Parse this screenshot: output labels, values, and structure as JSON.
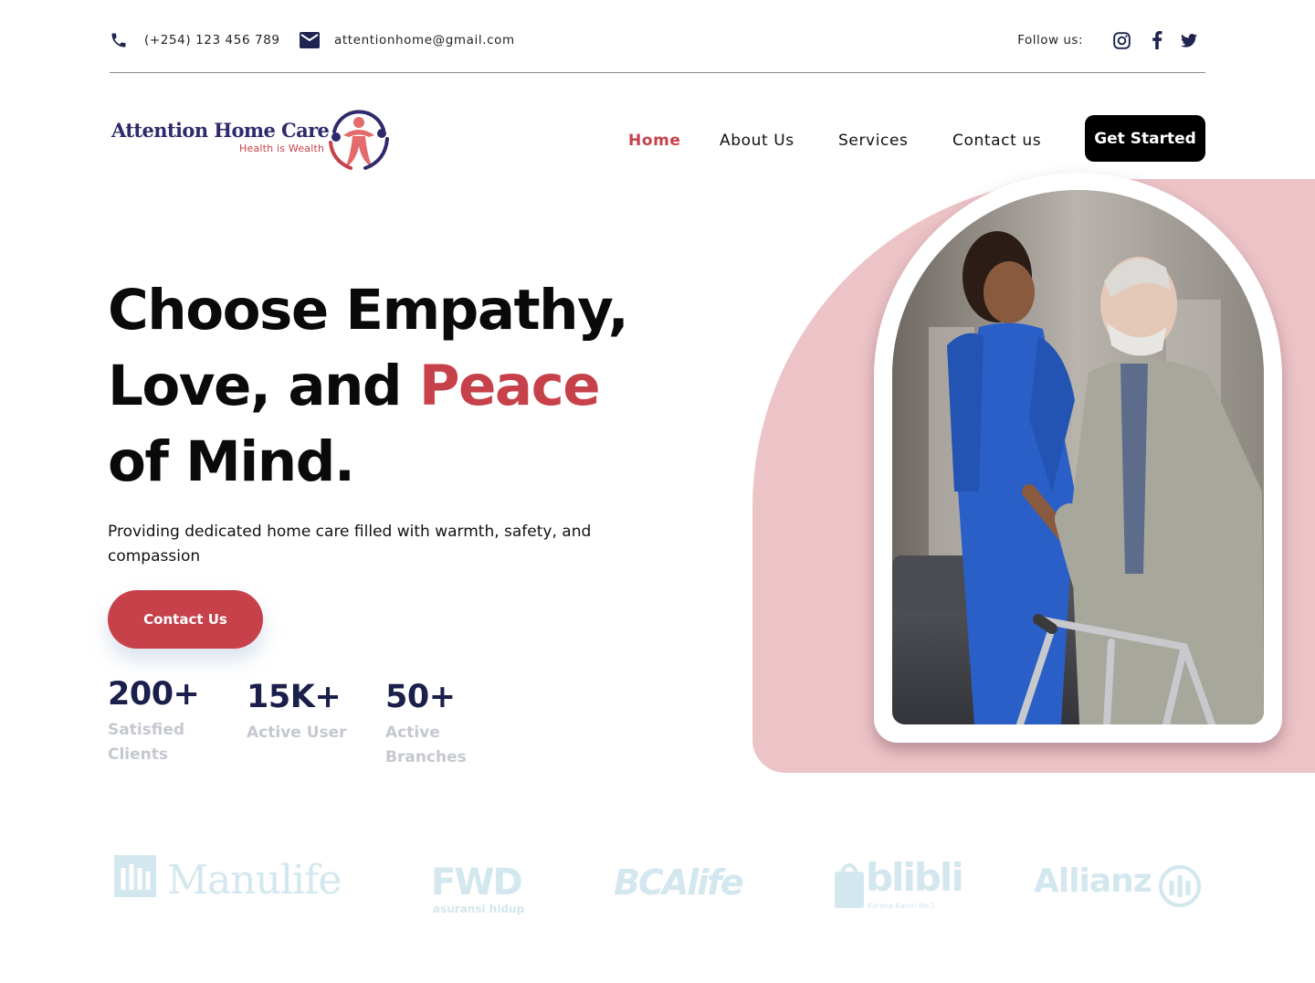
{
  "topbar": {
    "phone": "(+254) 123 456 789",
    "email": "attentionhome@gmail.com",
    "follow_label": "Follow us:",
    "social_icons": [
      "instagram-icon",
      "facebook-icon",
      "twitter-icon"
    ]
  },
  "logo": {
    "name": "Attention Home Care",
    "tagline": "Health is Wealth"
  },
  "nav": {
    "items": [
      "Home",
      "About Us",
      "Services",
      "Contact us"
    ],
    "active": "Home",
    "cta_label": "Get Started"
  },
  "hero": {
    "headline_line1": "Choose Empathy,",
    "headline_line2_prefix": "Love, and ",
    "headline_line2_accent": "Peace",
    "headline_line3": "of Mind.",
    "subtitle": "Providing dedicated home care filled with warmth, safety, and compassion",
    "cta_label": "Contact Us",
    "image_alt": "Nurse in blue scrubs helping an elderly man with a walker"
  },
  "stats": [
    {
      "value": "200+",
      "label": "Satisfied Clients"
    },
    {
      "value": "15K+",
      "label": "Active User"
    },
    {
      "value": "50+",
      "label": "Active Branches"
    }
  ],
  "partners": {
    "manulife": "Manulife",
    "fwd": "FWD",
    "fwd_sub": "asuransi hidup",
    "bca": "BCAlife",
    "blibli": "blibli",
    "blibli_sub": "Karena Kamu No.1",
    "allianz": "Allianz"
  },
  "colors": {
    "accent": "#c7414b",
    "brand_navy": "#2f2a6b",
    "stat_navy": "#1a1f4b",
    "hero_pink": "#ecc4c7",
    "partner_tint": "#d3e7ee"
  }
}
